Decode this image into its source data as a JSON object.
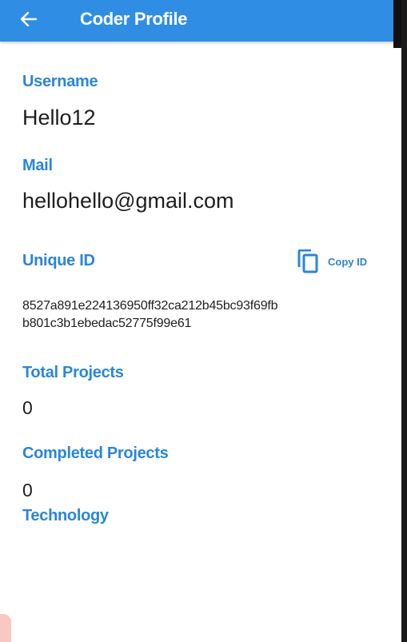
{
  "app_bar": {
    "title": "Coder Profile",
    "back_icon": "arrow-left-icon",
    "color": "#2f8ee4"
  },
  "profile": {
    "username_label": "Username",
    "username_value": "Hello12",
    "mail_label": "Mail",
    "mail_value": "hellohello@gmail.com",
    "unique_id_label": "Unique ID",
    "copy_button_label": "Copy ID",
    "copy_icon": "copy-icon",
    "unique_id_line1": "8527a891e224136950ff32ca212b45bc93f69fb",
    "unique_id_line2": "b801c3b1ebedac52775f99e61",
    "total_projects_label": "Total Projects",
    "total_projects_value": "0",
    "completed_projects_label": "Completed Projects",
    "completed_projects_value": "0",
    "technology_label": "Technology"
  },
  "colors": {
    "label": "#2a86d9",
    "text": "#1e1e1e",
    "background": "#ffffff"
  }
}
